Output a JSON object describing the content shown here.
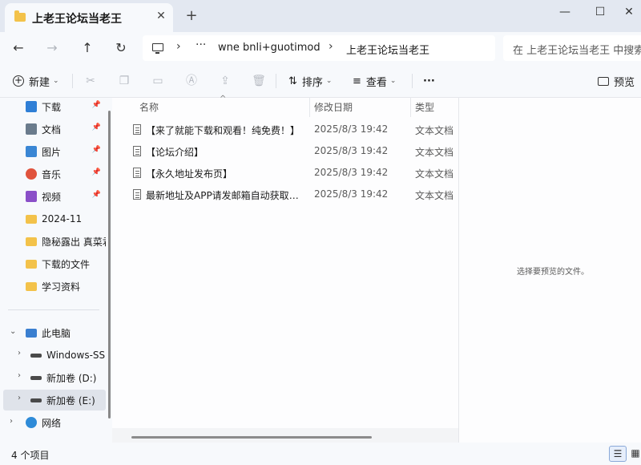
{
  "window": {
    "tab_title": "上老王论坛当老王",
    "tab_close": "✕",
    "new_tab": "+",
    "minimize": "—",
    "maximize": "☐",
    "close": "✕"
  },
  "nav": {
    "back": "←",
    "forward": "→",
    "up": "↑",
    "refresh": "↻"
  },
  "address": {
    "sep": "›",
    "overflow": "···",
    "crumbs": [
      "wne bnli+guotimod",
      "上老王论坛当老王"
    ]
  },
  "search": {
    "placeholder": "在 上老王论坛当老王 中搜索"
  },
  "toolbar": {
    "new_label": "新建",
    "sort_label": "排序",
    "view_label": "查看",
    "more": "···",
    "preview_label": "预览"
  },
  "sidebar": {
    "quick": [
      {
        "label": "下载",
        "icon": "download-icon",
        "color": "#2f7fd6",
        "pinned": true
      },
      {
        "label": "文档",
        "icon": "documents-icon",
        "color": "#6a7b8c",
        "pinned": true
      },
      {
        "label": "图片",
        "icon": "pictures-icon",
        "color": "#3a86d4",
        "pinned": true
      },
      {
        "label": "音乐",
        "icon": "music-icon",
        "color": "#e0533d",
        "pinned": true
      },
      {
        "label": "视频",
        "icon": "videos-icon",
        "color": "#8a4fc8",
        "pinned": true
      },
      {
        "label": "2024-11",
        "icon": "folder-icon",
        "color": "#f3c24a",
        "pinned": false
      },
      {
        "label": "隐秘露出 真菜君",
        "icon": "folder-icon",
        "color": "#f3c24a",
        "pinned": false
      },
      {
        "label": "下载的文件",
        "icon": "folder-icon",
        "color": "#f3c24a",
        "pinned": false
      },
      {
        "label": "学习资料",
        "icon": "folder-icon",
        "color": "#f3c24a",
        "pinned": false
      }
    ],
    "pin_glyph": "📌",
    "this_pc": "此电脑",
    "drives": [
      {
        "label": "Windows-SSD",
        "selected": false
      },
      {
        "label": "新加卷 (D:)",
        "selected": false
      },
      {
        "label": "新加卷 (E:)",
        "selected": true
      }
    ],
    "network": "网络"
  },
  "columns": {
    "name": "名称",
    "date": "修改日期",
    "type": "类型"
  },
  "files": [
    {
      "name": "【来了就能下载和观看！纯免费！】",
      "date": "2025/8/3 19:42",
      "type": "文本文档"
    },
    {
      "name": "【论坛介绍】",
      "date": "2025/8/3 19:42",
      "type": "文本文档"
    },
    {
      "name": "【永久地址发布页】",
      "date": "2025/8/3 19:42",
      "type": "文本文档"
    },
    {
      "name": "最新地址及APP请发邮箱自动获取！...",
      "date": "2025/8/3 19:42",
      "type": "文本文档"
    }
  ],
  "preview_pane": {
    "empty_text": "选择要预览的文件。"
  },
  "status": {
    "item_count": "4 个项目"
  }
}
